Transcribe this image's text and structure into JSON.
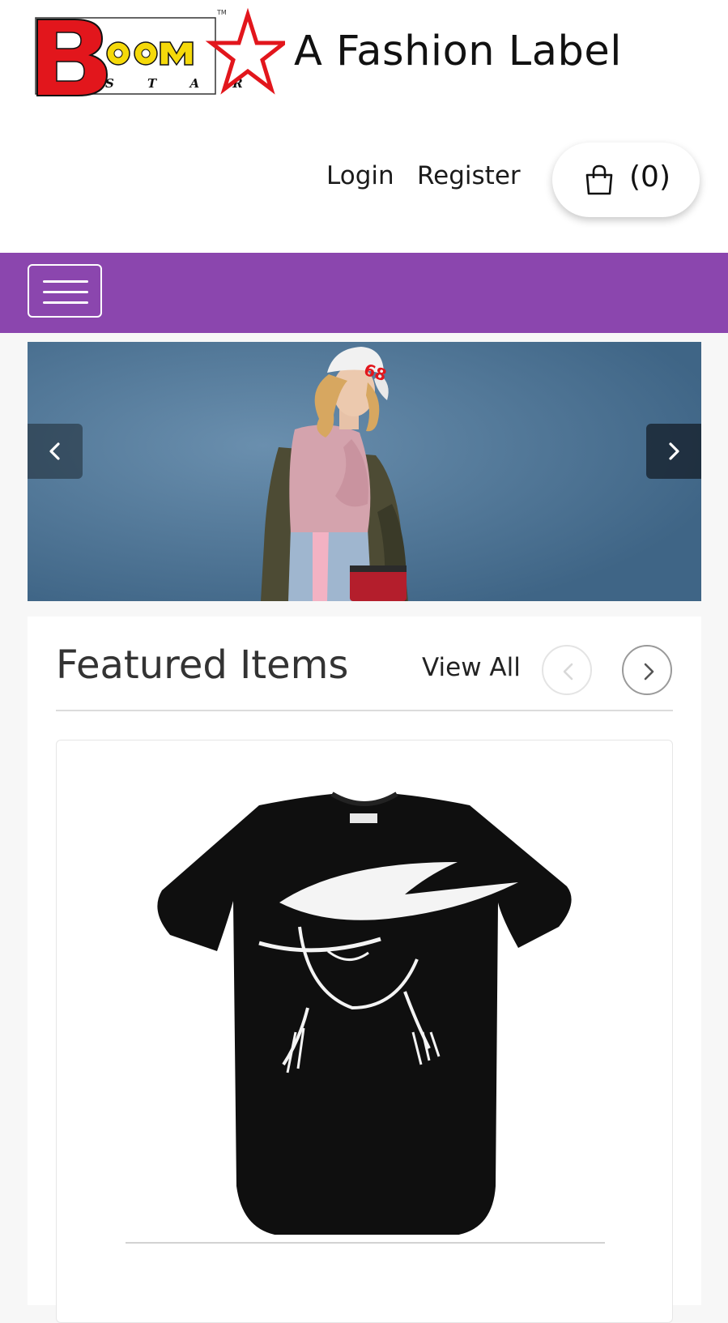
{
  "header": {
    "brand_word": "BOOM",
    "brand_sub": "STAR",
    "brand_tm": "TM",
    "tagline": "A Fashion Label",
    "login_label": "Login",
    "register_label": "Register",
    "cart_count": "(0)"
  },
  "navbar": {
    "color": "#8b46ae"
  },
  "hero": {
    "cap_number": "68"
  },
  "featured": {
    "title": "Featured Items",
    "view_all_label": "View All"
  },
  "colors": {
    "brand_red": "#e2161c",
    "brand_yellow": "#f5d90a",
    "navbar_purple": "#8b46ae"
  }
}
